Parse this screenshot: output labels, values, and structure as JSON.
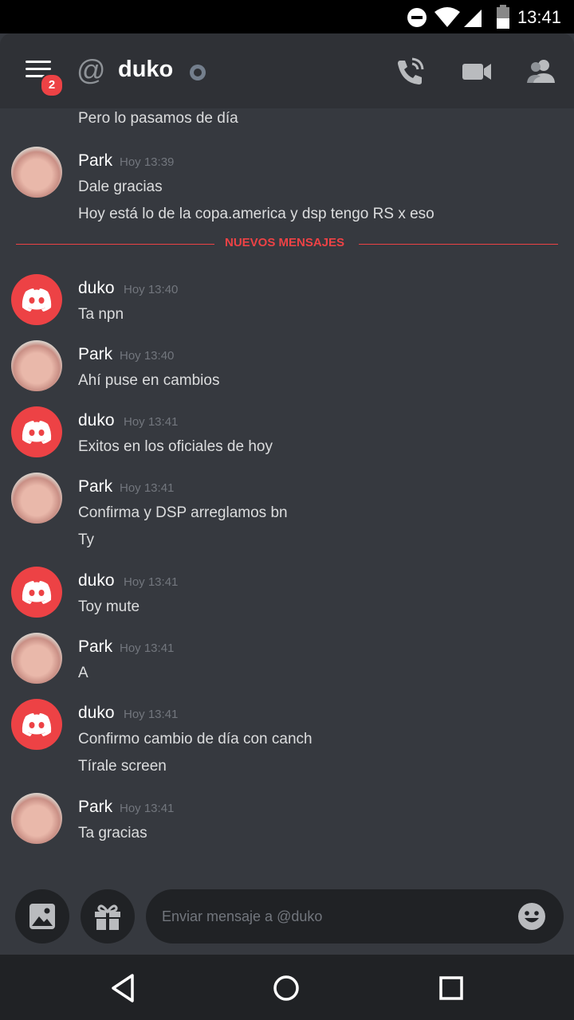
{
  "status_bar": {
    "time": "13:41"
  },
  "header": {
    "title": "duko",
    "at_symbol": "@",
    "menu_badge": "2",
    "icons": [
      "menu-icon",
      "call-icon",
      "video-icon",
      "members-icon"
    ]
  },
  "messages": {
    "m0": {
      "lines": [
        "Pero lo pasamos de día"
      ]
    },
    "m1": {
      "user": "Park",
      "time": "Hoy 13:39",
      "lines": [
        "Dale gracias",
        "Hoy está lo de la copa.america y dsp tengo RS x eso"
      ]
    },
    "divider": "NUEVOS MENSAJES",
    "m2": {
      "user": "duko",
      "time": "Hoy 13:40",
      "lines": [
        "Ta npn"
      ]
    },
    "m3": {
      "user": "Park",
      "time": "Hoy 13:40",
      "lines": [
        "Ahí puse en cambios"
      ]
    },
    "m4": {
      "user": "duko",
      "time": "Hoy 13:41",
      "lines": [
        "Exitos en los oficiales de hoy"
      ]
    },
    "m5": {
      "user": "Park",
      "time": "Hoy 13:41",
      "lines": [
        "Confirma y DSP arreglamos bn",
        "Ty"
      ]
    },
    "m6": {
      "user": "duko",
      "time": "Hoy 13:41",
      "lines": [
        "Toy mute"
      ]
    },
    "m7": {
      "user": "Park",
      "time": "Hoy 13:41",
      "lines": [
        "A"
      ]
    },
    "m8": {
      "user": "duko",
      "time": "Hoy 13:41",
      "lines": [
        "Confirmo cambio de día con canch",
        "Tírale screen"
      ]
    },
    "m9": {
      "user": "Park",
      "time": "Hoy 13:41",
      "lines": [
        "Ta gracias"
      ]
    }
  },
  "composer": {
    "placeholder": "Enviar mensaje a @duko"
  },
  "colors": {
    "background": "#36393f",
    "header": "#2f3136",
    "accent_red": "#ed4245",
    "discord_avatar": "#ed4245"
  }
}
